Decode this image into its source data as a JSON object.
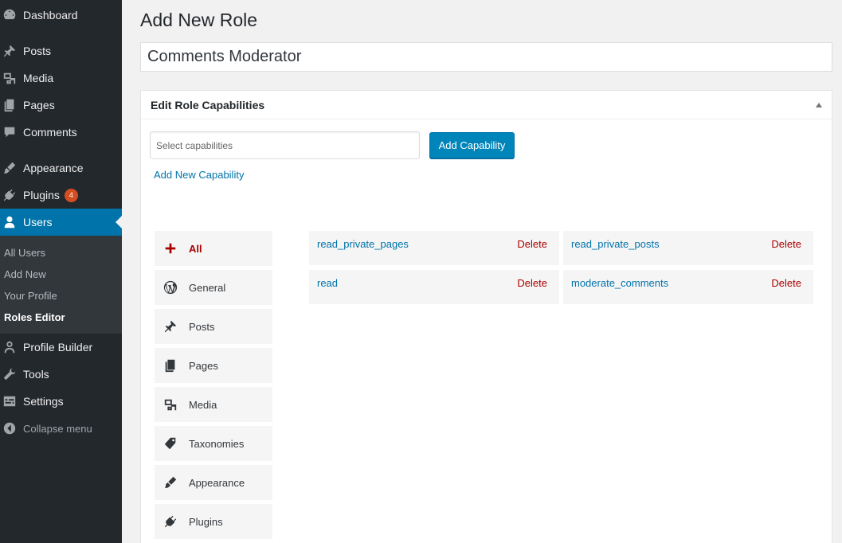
{
  "sidebar": {
    "items": [
      {
        "label": "Dashboard",
        "icon": "dashboard-icon"
      },
      {
        "label": "Posts",
        "icon": "pin-icon"
      },
      {
        "label": "Media",
        "icon": "media-icon"
      },
      {
        "label": "Pages",
        "icon": "pages-icon"
      },
      {
        "label": "Comments",
        "icon": "comment-icon"
      },
      {
        "label": "Appearance",
        "icon": "paintbrush-icon"
      },
      {
        "label": "Plugins",
        "icon": "plugin-icon",
        "badge": "4"
      },
      {
        "label": "Users",
        "icon": "user-icon"
      },
      {
        "label": "Profile Builder",
        "icon": "user-icon"
      },
      {
        "label": "Tools",
        "icon": "wrench-icon"
      },
      {
        "label": "Settings",
        "icon": "settings-icon"
      },
      {
        "label": "Collapse menu",
        "icon": "collapse-icon"
      }
    ],
    "submenu": [
      "All Users",
      "Add New",
      "Your Profile",
      "Roles Editor"
    ]
  },
  "page": {
    "title": "Add New Role",
    "role_name": "Comments Moderator"
  },
  "postbox": {
    "title": "Edit Role Capabilities",
    "select_placeholder": "Select capabilities",
    "add_button": "Add Capability",
    "add_new_link": "Add New Capability"
  },
  "groups": [
    {
      "label": "All",
      "icon": "plus-icon"
    },
    {
      "label": "General",
      "icon": "wordpress-icon"
    },
    {
      "label": "Posts",
      "icon": "pin-icon"
    },
    {
      "label": "Pages",
      "icon": "pages-icon"
    },
    {
      "label": "Media",
      "icon": "media-icon"
    },
    {
      "label": "Taxonomies",
      "icon": "tag-icon"
    },
    {
      "label": "Appearance",
      "icon": "paintbrush-icon"
    },
    {
      "label": "Plugins",
      "icon": "plugin-icon"
    }
  ],
  "capabilities": [
    {
      "name": "read_private_pages",
      "delete": "Delete"
    },
    {
      "name": "read_private_posts",
      "delete": "Delete"
    },
    {
      "name": "read",
      "delete": "Delete"
    },
    {
      "name": "moderate_comments",
      "delete": "Delete"
    }
  ],
  "colors": {
    "accent": "#0073aa",
    "sidebar": "#23282d",
    "delete": "#aa0000",
    "badge": "#d54e21"
  }
}
